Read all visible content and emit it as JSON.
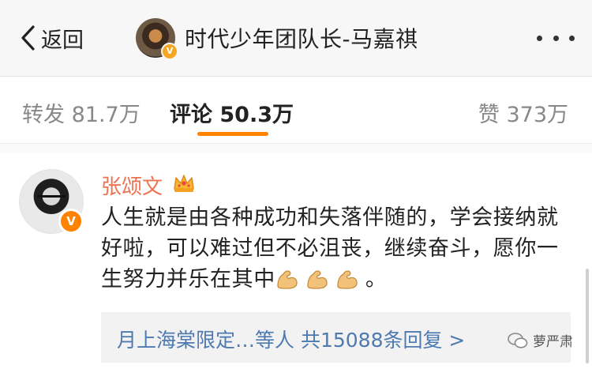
{
  "nav": {
    "back_label": "返回",
    "title": "时代少年团队长-马嘉祺",
    "verified_badge": "V"
  },
  "tabs": {
    "repost": "转发 81.7万",
    "comment": "评论 50.3万",
    "like": "赞 373万",
    "active": "comment",
    "accent_color": "#ff8200"
  },
  "comment": {
    "author": "张颂文",
    "author_color": "#eb7350",
    "author_badge_icon": "crown-icon",
    "verified_badge": "V",
    "text": "人生就是由各种成功和失落伴随的，学会接纳就好啦，可以难过但不必沮丧，继续奋斗，愿你一生努力并乐在其中",
    "emoji": [
      "flexed-biceps",
      "flexed-biceps",
      "flexed-biceps"
    ],
    "text_end": "。",
    "replies_summary": "月上海棠限定…等人  共15088条回复 >"
  },
  "watermark": {
    "label": "萝严肃"
  }
}
